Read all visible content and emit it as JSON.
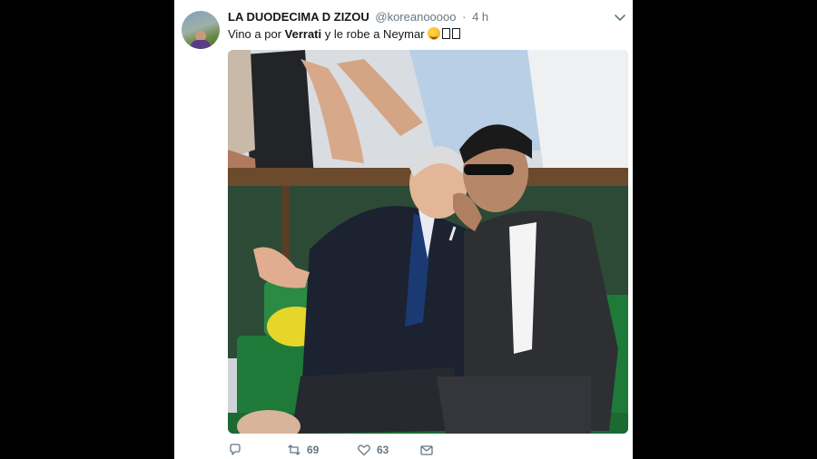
{
  "tweet": {
    "display_name": "LA DUODECIMA D ZIZOU",
    "handle": "@koreanooooo",
    "separator": "·",
    "timestamp": "4 h",
    "text_before": "Vino a por ",
    "text_bold": "Verrati",
    "text_after": " y le robe a Neymar",
    "retweet_count": "69",
    "like_count": "63"
  },
  "icons": {
    "caret": "chevron-down-icon",
    "reply": "reply-icon",
    "retweet": "retweet-icon",
    "like": "heart-icon",
    "dm": "envelope-icon"
  },
  "colors": {
    "background": "#000000",
    "card": "#ffffff",
    "text": "#14171a",
    "muted": "#657786"
  }
}
